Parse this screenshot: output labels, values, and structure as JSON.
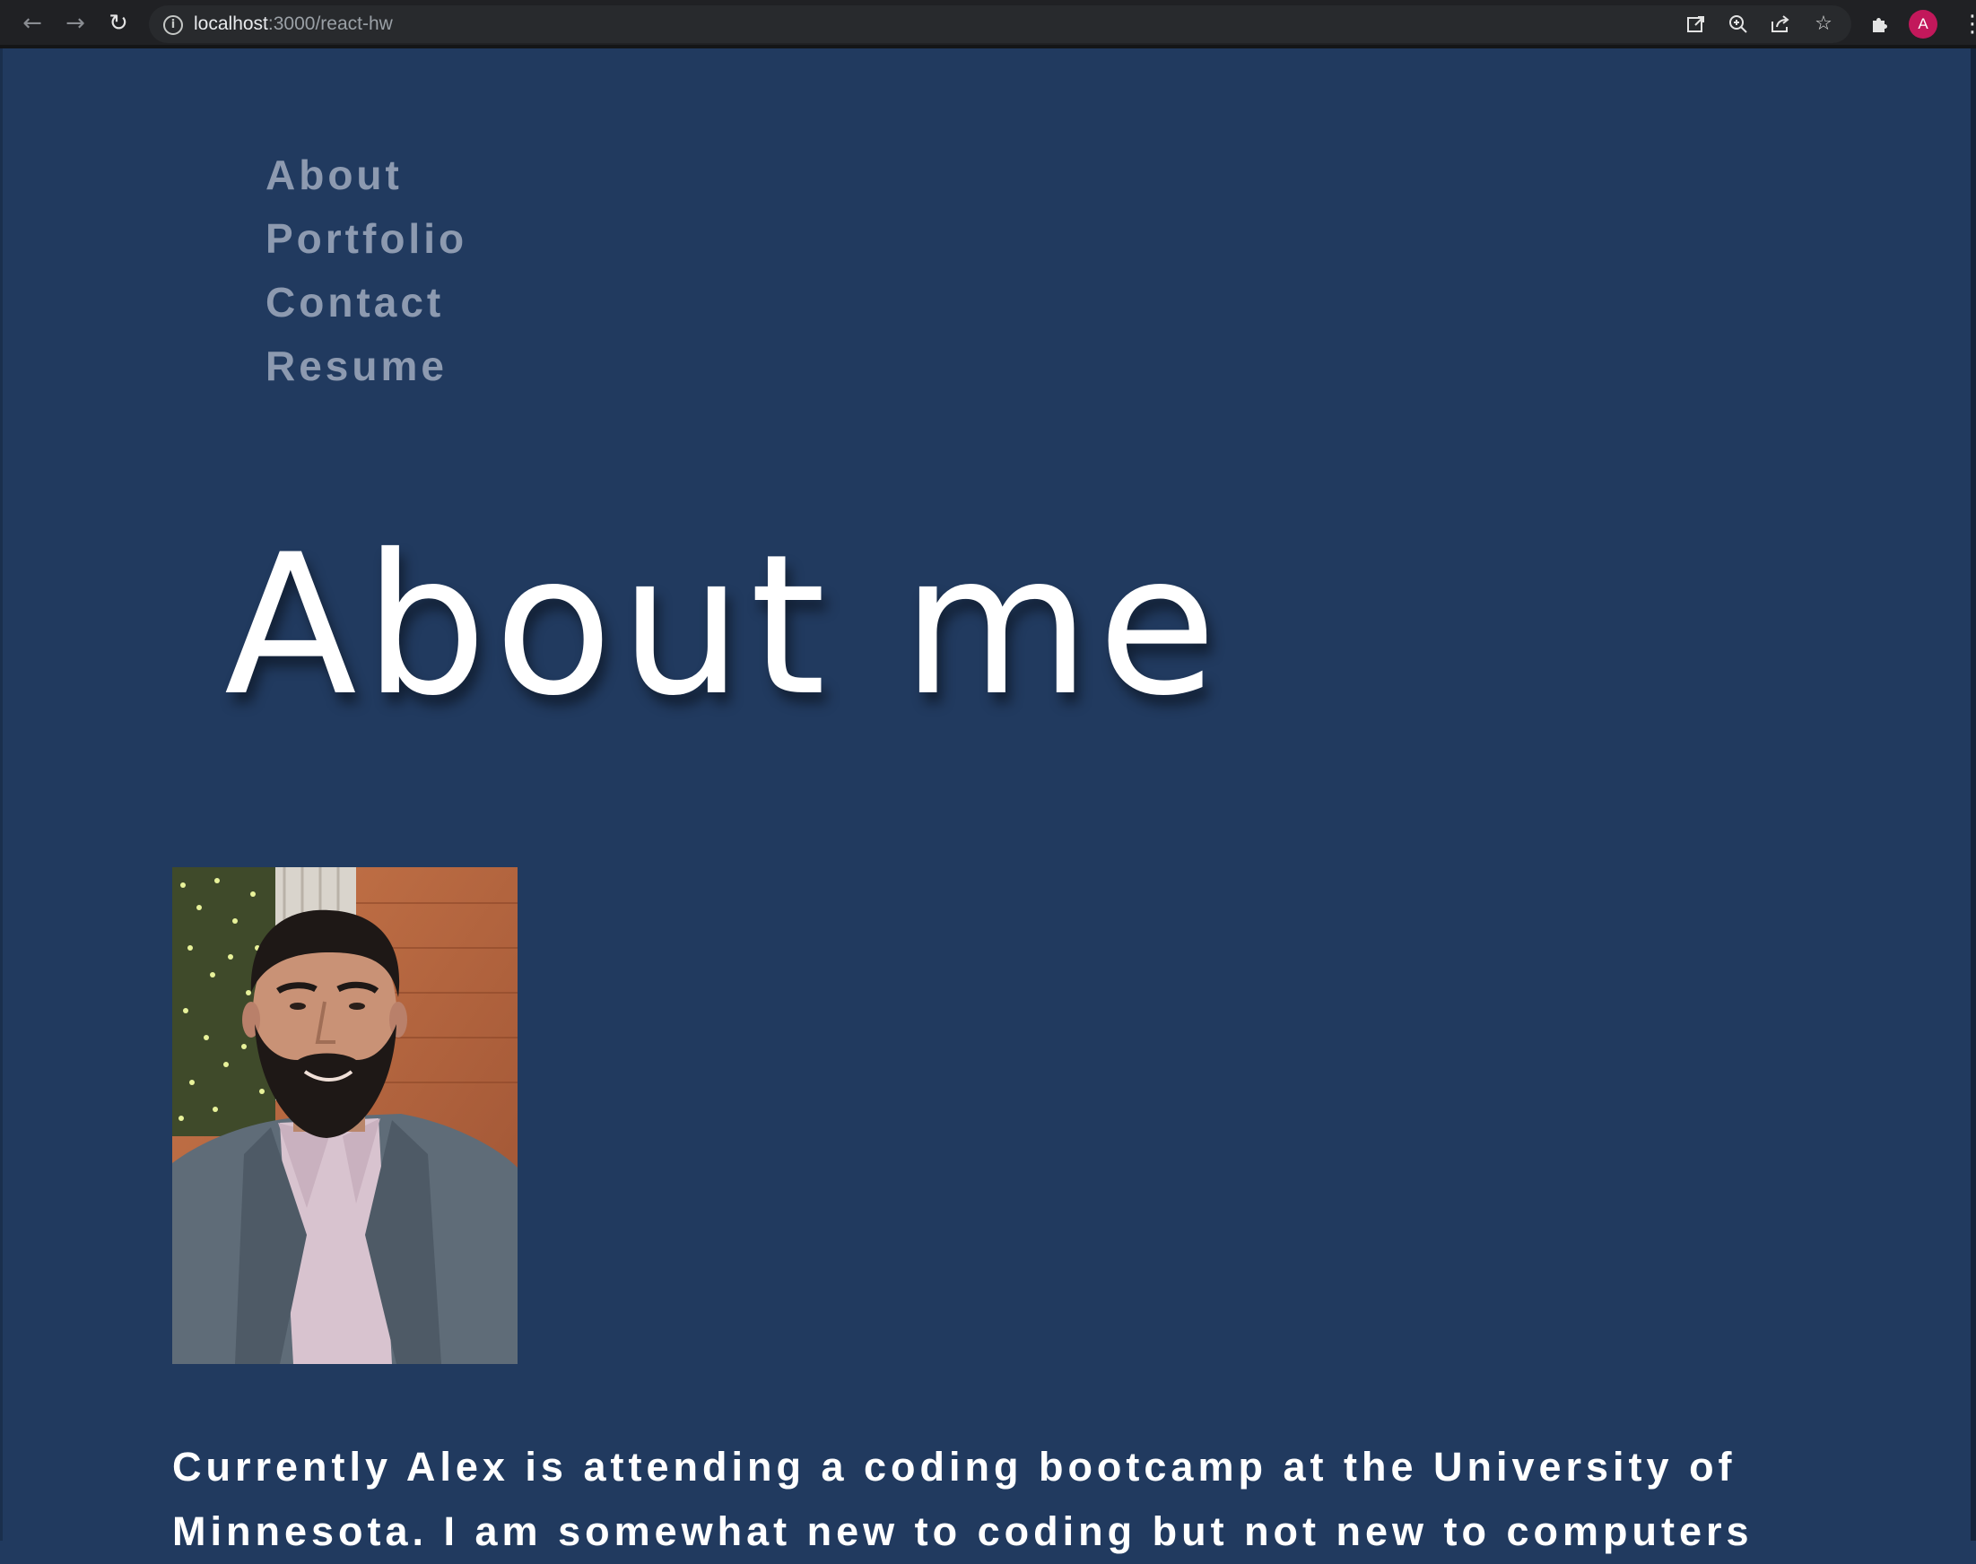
{
  "browser": {
    "url_host": "localhost",
    "url_path": ":3000/react-hw",
    "profile_initial": "A"
  },
  "nav": {
    "items": [
      "About",
      "Portfolio",
      "Contact",
      "Resume"
    ]
  },
  "about": {
    "title": "About me",
    "bio": "Currently Alex is attending a coding bootcamp at the University of Minnesota. I am somewhat new to coding but not new to computers"
  },
  "colors": {
    "page_background": "#213a5f",
    "nav_link": "#8d9ab0",
    "text": "#ffffff",
    "avatar": "#c2185b"
  },
  "icons": {
    "browser_controls": [
      "back-arrow-icon",
      "forward-arrow-icon",
      "reload-icon"
    ],
    "omnibox": [
      "info-icon",
      "open-in-app-icon",
      "zoom-icon",
      "share-icon",
      "star-icon"
    ],
    "toolbar": [
      "extensions-puzzle-icon",
      "more-menu-icon"
    ]
  }
}
